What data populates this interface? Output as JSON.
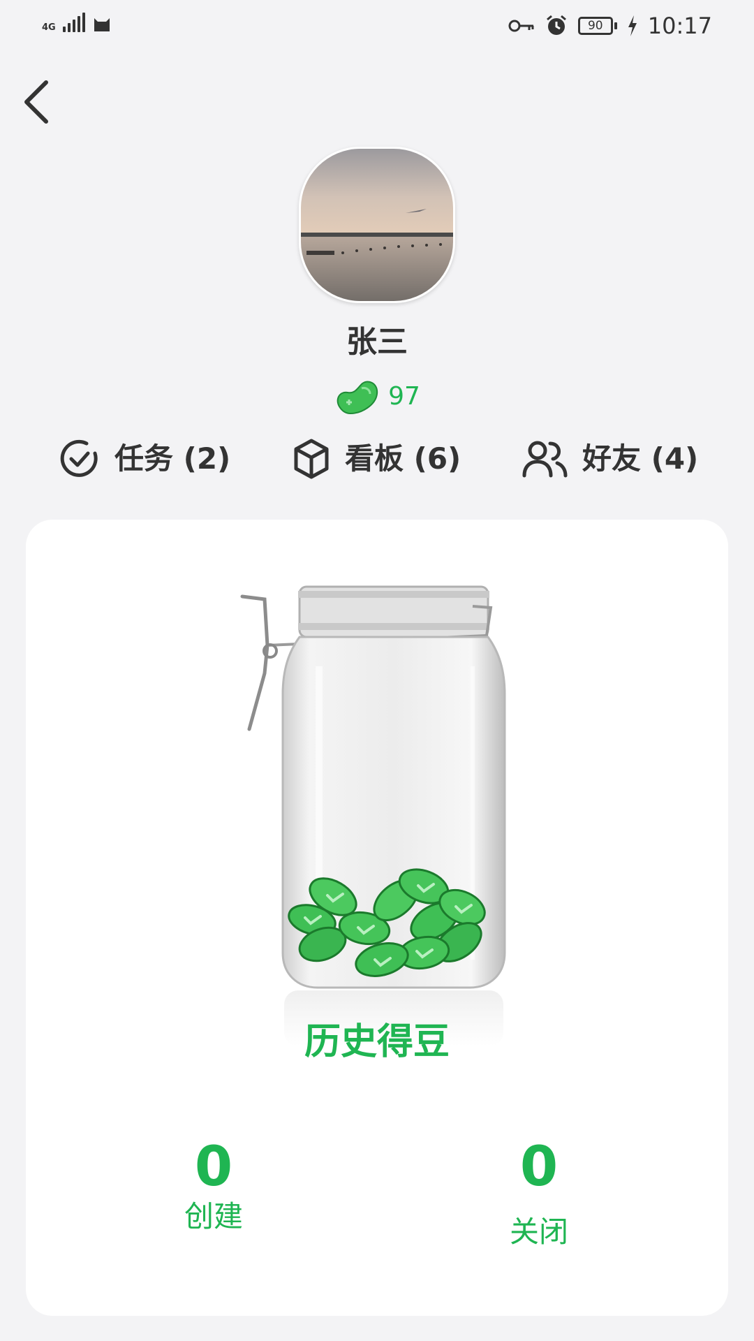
{
  "status_bar": {
    "network": "4G",
    "battery": "90",
    "time": "10:17"
  },
  "profile": {
    "name": "张三",
    "points": "97"
  },
  "stats": [
    {
      "label": "任务 (2)",
      "icon": "check-circle-icon"
    },
    {
      "label": "看板 (6)",
      "icon": "box-icon"
    },
    {
      "label": "好友 (4)",
      "icon": "friends-icon"
    }
  ],
  "card": {
    "title": "历史得豆",
    "metrics": [
      {
        "value": "0",
        "label": "创建"
      },
      {
        "value": "0",
        "label": "关闭"
      }
    ]
  },
  "colors": {
    "accent": "#1fb552",
    "background": "#f3f3f5",
    "text": "#333333"
  }
}
